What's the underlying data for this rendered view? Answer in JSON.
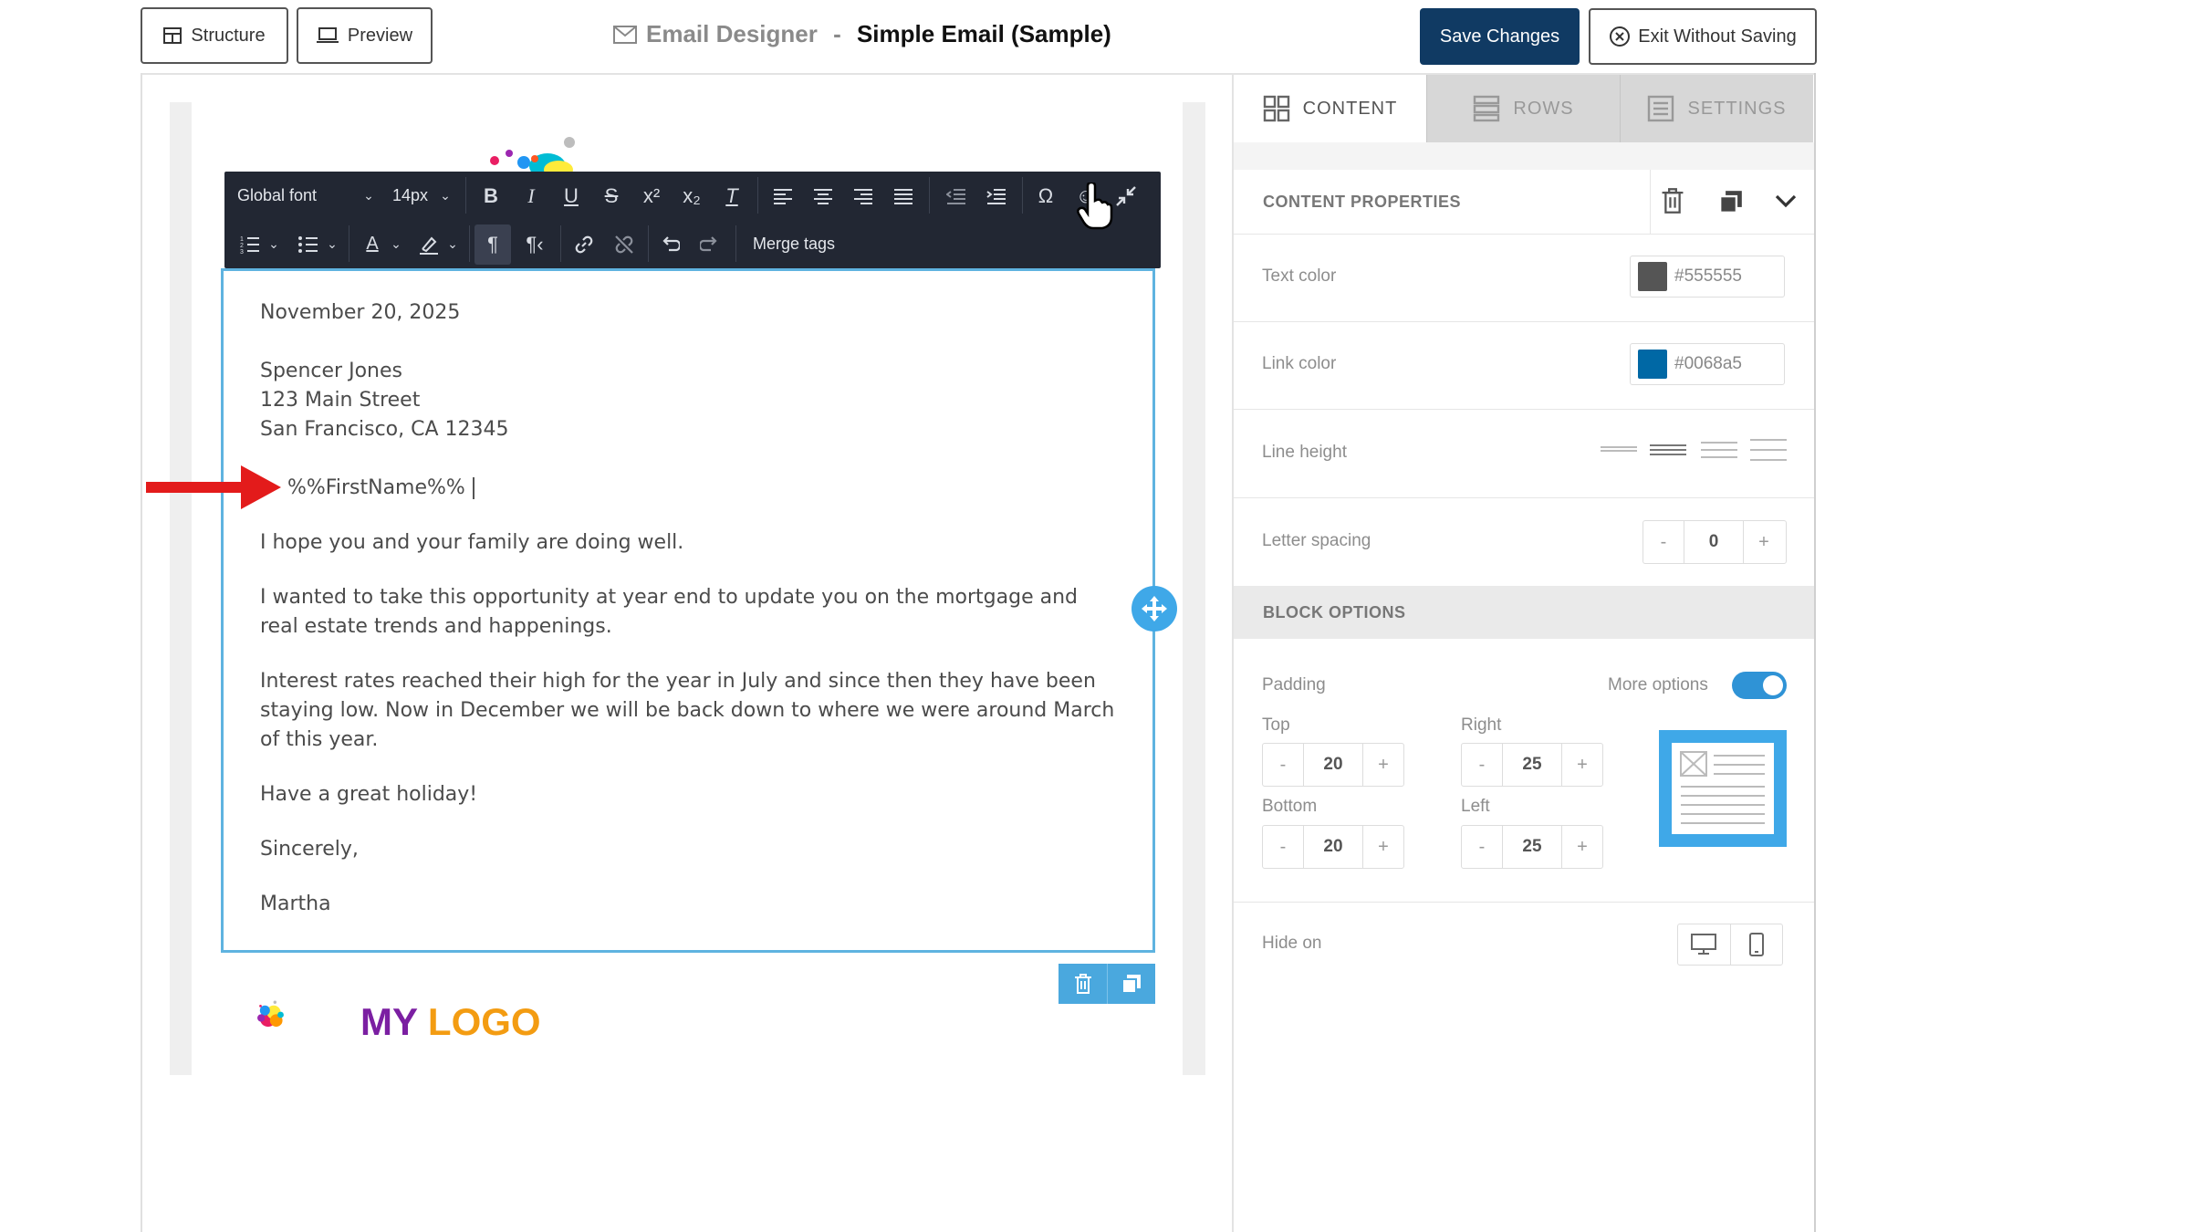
{
  "header": {
    "structure_label": "Structure",
    "preview_label": "Preview",
    "title_app": "Email Designer",
    "title_separator": " - ",
    "title_doc": "Simple Email (Sample)",
    "save_label": "Save Changes",
    "exit_label": "Exit Without Saving"
  },
  "toolbar": {
    "font": "Global font",
    "size": "14px",
    "merge_tags": "Merge tags"
  },
  "email": {
    "date": "November 20, 2025",
    "address_name": "Spencer Jones",
    "address_street": "123 Main Street",
    "address_city": "San Francisco, CA 12345",
    "greeting": "%%FirstName%%",
    "p1": "I hope you and your family are doing well.",
    "p2": "I wanted to take this opportunity at year end to update you on the mortgage and real estate trends and happenings.",
    "p3": "Interest rates reached their high for the year in July and since then they have been staying low. Now in December we will be back down to where we were around March of this year.",
    "p4": "Have a great holiday!",
    "closing": "Sincerely,",
    "signature": "Martha"
  },
  "logo": {
    "word1": "MY",
    "word2": "LOGO",
    "color1": "#7b1fa2",
    "color2": "#f39c12"
  },
  "panel": {
    "tabs": [
      {
        "label": "CONTENT"
      },
      {
        "label": "ROWS"
      },
      {
        "label": "SETTINGS"
      }
    ],
    "content_properties": "CONTENT PROPERTIES",
    "text_color_label": "Text color",
    "text_color_value": "#555555",
    "link_color_label": "Link color",
    "link_color_value": "#0068a5",
    "line_height_label": "Line height",
    "letter_spacing_label": "Letter spacing",
    "letter_spacing_value": "0",
    "block_options": "BLOCK OPTIONS",
    "padding_label": "Padding",
    "more_options_label": "More options",
    "top_label": "Top",
    "top_value": "20",
    "right_label": "Right",
    "right_value": "25",
    "bottom_label": "Bottom",
    "bottom_value": "20",
    "left_label": "Left",
    "left_value": "25",
    "hide_on_label": "Hide on",
    "minus": "-",
    "plus": "+"
  }
}
